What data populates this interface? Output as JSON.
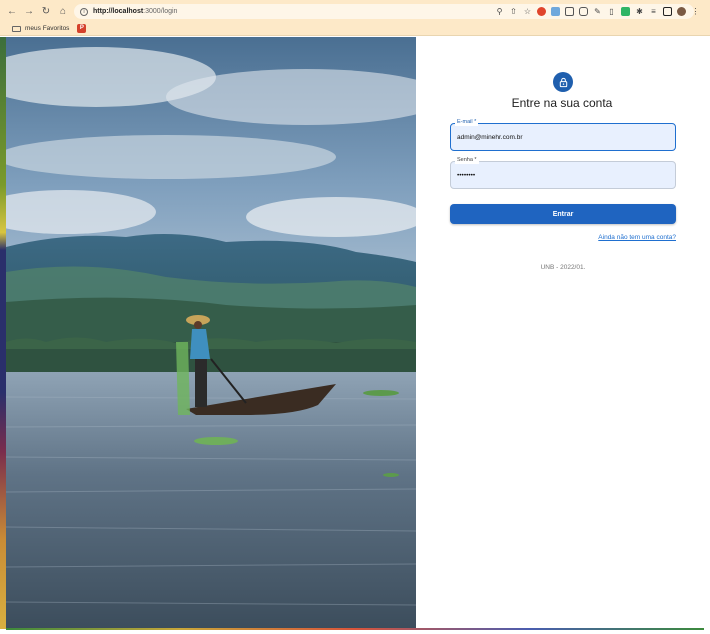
{
  "browser": {
    "url_host": "http://localhost",
    "url_rest": ":3000/login",
    "bookmarks": {
      "folder_label": "meus Favoritos",
      "badge_text": "P"
    }
  },
  "login": {
    "title": "Entre na sua conta",
    "email": {
      "label": "E-mail *",
      "value": "admin@minehr.com.br"
    },
    "password": {
      "label": "Senha *",
      "value": "••••••••"
    },
    "submit_label": "Entrar",
    "signup_link": "Ainda não tem uma conta?",
    "footer": "UNB - 2022/01."
  },
  "colors": {
    "primary": "#1f64c0",
    "chrome": "#fde9c8",
    "field_bg": "#e8f0fe"
  }
}
